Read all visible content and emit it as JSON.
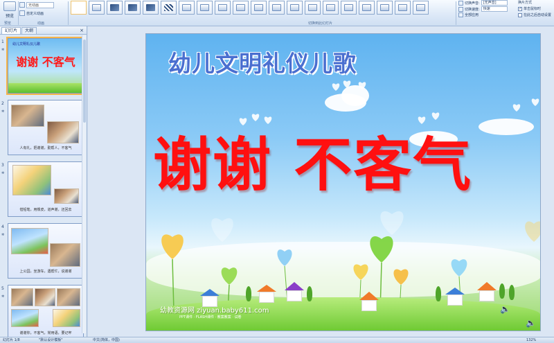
{
  "ribbon": {
    "preview_label": "预览",
    "preview_group_label": "预览",
    "animation_select": "无动画",
    "animation_label": "动画",
    "custom_animation_label": "自定义动画",
    "animation_group_label": "动画",
    "transition_group_label": "切换到此幻灯片",
    "transition_sound_label": "切换声音:",
    "transition_sound_value": "[无声音]",
    "transition_speed_label": "切换速度:",
    "transition_speed_value": "快速",
    "apply_all_label": "全部应用",
    "advance_label": "换片方式",
    "on_click_label": "单击鼠标时",
    "auto_after_label": "在此之后自动设置"
  },
  "panel": {
    "tab_slides": "幻灯片",
    "tab_outline": "大纲",
    "close": "×",
    "slides": [
      {
        "num": "1",
        "title": "幼儿文明礼仪儿歌",
        "heading": "谢谢 不客气",
        "caption": ""
      },
      {
        "num": "2",
        "caption": "人有礼，把谢谢，勤帮人，不客气"
      },
      {
        "num": "3",
        "caption": "借铅笔，用橡皮，道声谢，还回去"
      },
      {
        "num": "4",
        "caption": "上公园，坐游车，遇帮忙，说谢谢"
      },
      {
        "num": "5",
        "caption": "谢谢你，不客气，常用语，要记牢"
      }
    ]
  },
  "slide": {
    "title": "幼儿文明礼仪儿歌",
    "heading": "谢谢 不客气",
    "watermark": "幼教资源网 ziyuan.baby611.com",
    "watermark_sub": "PPT课件 · FLASH课件 · 教案教案 · 试卷"
  },
  "status": {
    "slide_info": "幻灯片 1/8",
    "theme": "\"默认设计模板\"",
    "language": "中文(简体，中国)",
    "zoom": "132%"
  },
  "colors": {
    "heading_red": "#ff1010",
    "title_blue": "#4a6fd0"
  }
}
